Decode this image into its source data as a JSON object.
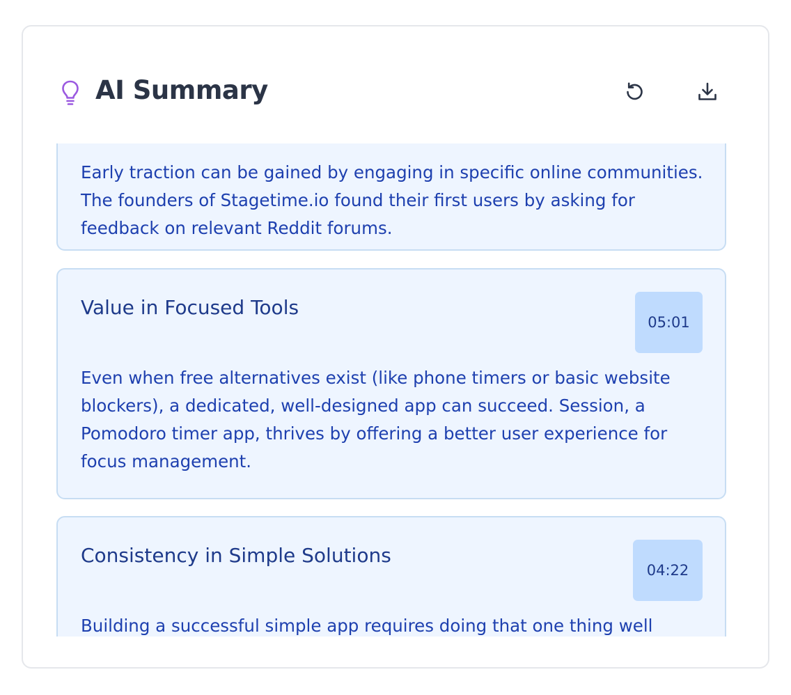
{
  "header": {
    "title": "AI Summary",
    "icons": {
      "title_icon": "lightbulb-icon",
      "refresh": "refresh-icon",
      "download": "download-icon"
    },
    "accent_color": "#9b59e0"
  },
  "cards": [
    {
      "title": "",
      "timestamp": "",
      "body": "Early traction can be gained by engaging in specific online communities. The founders of Stagetime.io found their first users by asking for feedback on relevant Reddit forums."
    },
    {
      "title": "Value in Focused Tools",
      "timestamp": "05:01",
      "body": "Even when free alternatives exist (like phone timers or basic website blockers), a dedicated, well-designed app can succeed. Session, a Pomodoro timer app, thrives by offering a better user experience for focus management."
    },
    {
      "title": "Consistency in Simple Solutions",
      "timestamp": "04:22",
      "body": "Building a successful simple app requires doing that one thing well"
    }
  ],
  "colors": {
    "card_bg": "#eef5ff",
    "card_border": "#c7ddf3",
    "timestamp_bg": "#bfdbfe",
    "text": "#1e40af",
    "title_text": "#2b3446"
  }
}
